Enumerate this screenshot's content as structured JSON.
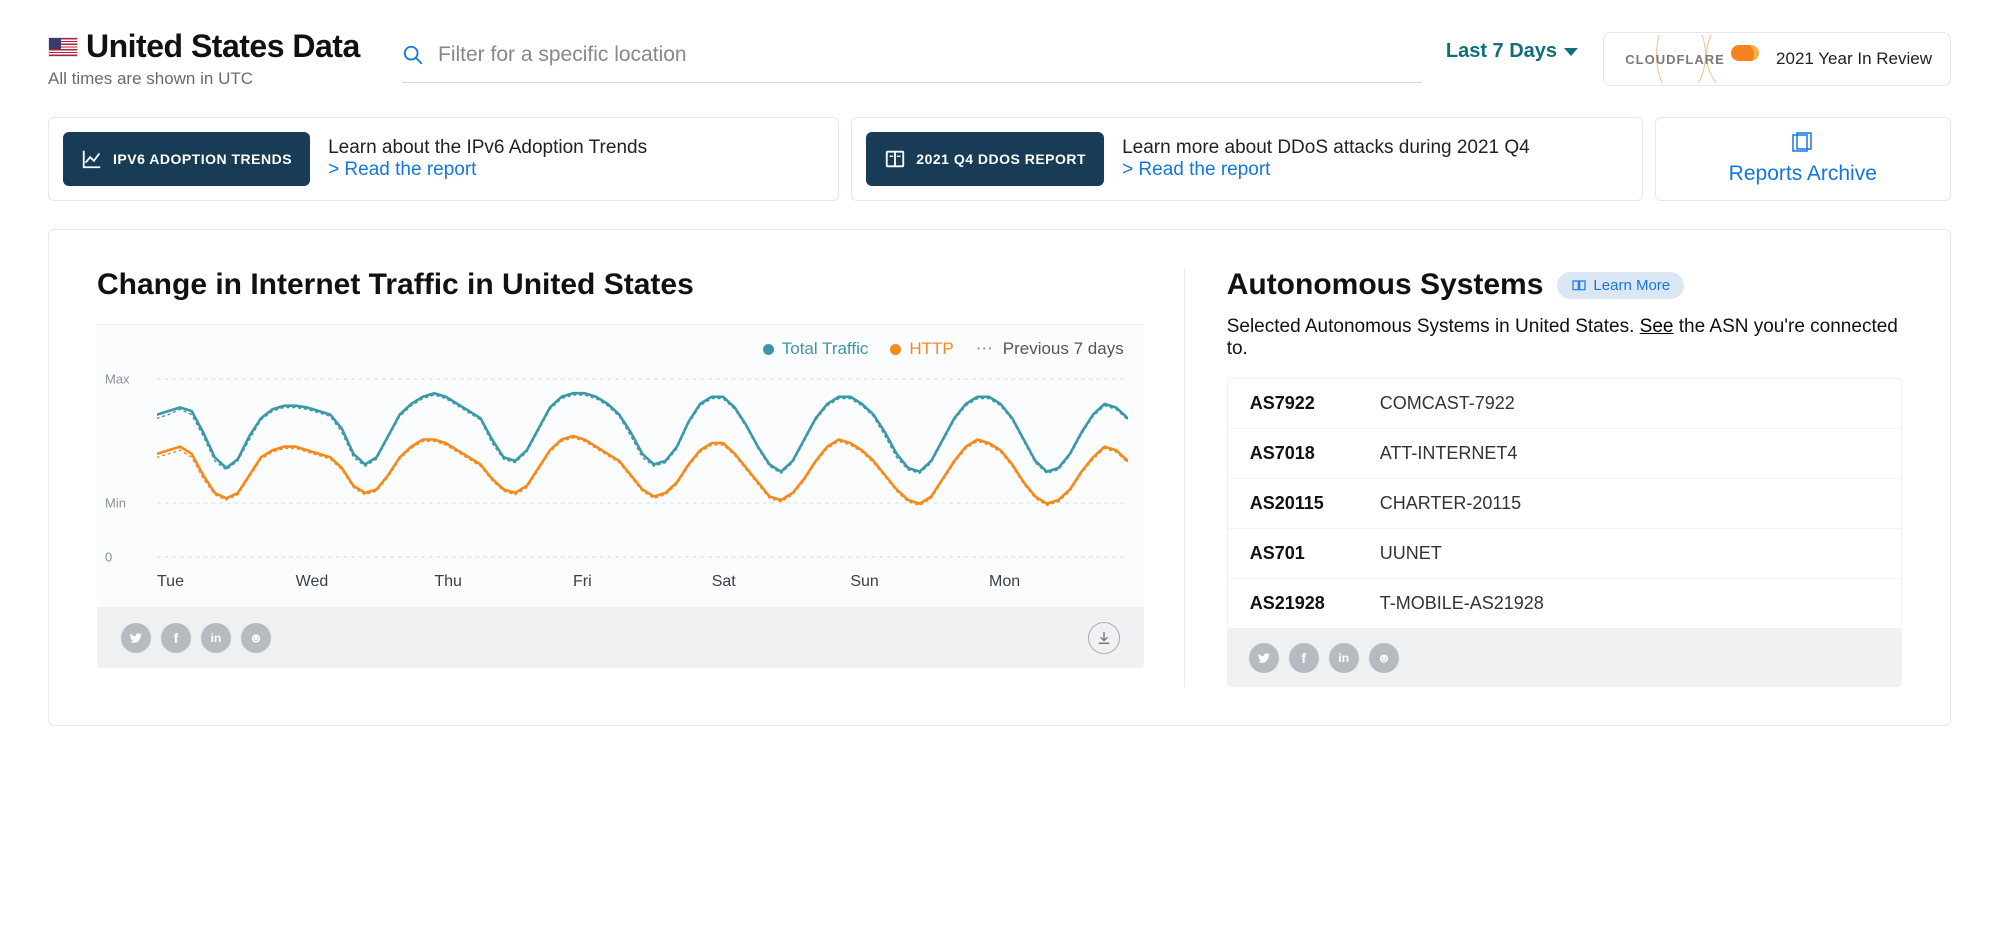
{
  "header": {
    "title": "United States Data",
    "tz_note": "All times are shown in UTC",
    "search_placeholder": "Filter for a specific location",
    "range_label": "Last 7 Days",
    "year_review_label": "2021 Year In Review",
    "cloudflare_wordmark": "CLOUDFLARE"
  },
  "promos": {
    "ipv6": {
      "badge": "IPV6 ADOPTION TRENDS",
      "headline": "Learn about the IPv6 Adoption Trends",
      "link": "> Read the report"
    },
    "ddos": {
      "badge": "2021 Q4 DDOS REPORT",
      "headline": "Learn more about DDoS attacks during 2021 Q4",
      "link": "> Read the report"
    },
    "archive_label": "Reports Archive"
  },
  "chart_panel": {
    "title": "Change in Internet Traffic in United States",
    "legend": {
      "total": "Total Traffic",
      "http": "HTTP",
      "prev": "Previous 7 days"
    },
    "y_ticks": [
      "Max",
      "Min",
      "0"
    ]
  },
  "chart_data": {
    "type": "line",
    "xlabel": "",
    "ylabel": "",
    "ylim_labels": [
      "0",
      "Min",
      "Max"
    ],
    "y_range_note": "normalized 0–100, Max≈100, Min≈30, 0 baseline at bottom",
    "categories": [
      "Tue",
      "Wed",
      "Thu",
      "Fri",
      "Sat",
      "Sun",
      "Mon"
    ],
    "x": [
      0,
      2,
      4,
      6,
      8,
      10,
      12,
      14,
      16,
      18,
      20,
      22,
      24,
      26,
      28,
      30,
      32,
      34,
      36,
      38,
      40,
      42,
      44,
      46,
      48,
      50,
      52,
      54,
      56,
      58,
      60,
      62,
      64,
      66,
      68,
      70,
      72,
      74,
      76,
      78,
      80,
      82,
      84,
      86,
      88,
      90,
      92,
      94,
      96,
      98,
      100,
      102,
      104,
      106,
      108,
      110,
      112,
      114,
      116,
      118,
      120,
      122,
      124,
      126,
      128,
      130,
      132,
      134,
      136,
      138,
      140,
      142,
      144,
      146,
      148,
      150,
      152,
      154,
      156,
      158,
      160,
      162,
      164,
      166,
      168
    ],
    "series": [
      {
        "name": "Total Traffic",
        "color": "#3a98a8",
        "values": [
          80,
          82,
          84,
          82,
          70,
          56,
          50,
          55,
          68,
          78,
          83,
          85,
          85,
          84,
          82,
          80,
          72,
          58,
          52,
          56,
          68,
          80,
          86,
          90,
          92,
          90,
          86,
          82,
          78,
          66,
          56,
          54,
          60,
          72,
          84,
          90,
          92,
          92,
          90,
          86,
          80,
          70,
          58,
          52,
          54,
          62,
          76,
          86,
          90,
          90,
          84,
          74,
          62,
          52,
          48,
          54,
          66,
          78,
          86,
          90,
          90,
          86,
          80,
          70,
          58,
          50,
          48,
          54,
          66,
          78,
          86,
          90,
          90,
          86,
          78,
          66,
          54,
          48,
          50,
          58,
          70,
          80,
          86,
          84,
          78
        ]
      },
      {
        "name": "HTTP",
        "color": "#f48a1c",
        "values": [
          58,
          60,
          62,
          58,
          46,
          36,
          33,
          36,
          46,
          56,
          60,
          62,
          62,
          60,
          58,
          56,
          50,
          40,
          36,
          38,
          46,
          56,
          62,
          66,
          66,
          64,
          60,
          56,
          52,
          44,
          38,
          36,
          40,
          50,
          60,
          66,
          68,
          66,
          62,
          58,
          54,
          46,
          38,
          34,
          36,
          42,
          52,
          60,
          64,
          64,
          58,
          50,
          42,
          34,
          32,
          36,
          44,
          54,
          62,
          66,
          64,
          60,
          54,
          46,
          38,
          32,
          30,
          34,
          44,
          54,
          62,
          66,
          64,
          60,
          52,
          42,
          34,
          30,
          32,
          38,
          48,
          56,
          62,
          60,
          54
        ]
      },
      {
        "name": "Total Traffic (prev 7 days)",
        "color": "#3a98a8",
        "style": "dotted",
        "values": [
          78,
          80,
          83,
          80,
          68,
          54,
          49,
          54,
          66,
          77,
          82,
          84,
          84,
          83,
          81,
          79,
          70,
          56,
          51,
          55,
          67,
          79,
          85,
          89,
          91,
          89,
          85,
          81,
          77,
          64,
          55,
          53,
          59,
          71,
          83,
          89,
          91,
          91,
          89,
          85,
          79,
          68,
          56,
          51,
          53,
          61,
          75,
          85,
          89,
          89,
          83,
          73,
          61,
          51,
          47,
          53,
          65,
          77,
          85,
          89,
          89,
          85,
          79,
          68,
          56,
          49,
          47,
          53,
          65,
          77,
          85,
          89,
          89,
          85,
          77,
          65,
          53,
          47,
          49,
          57,
          69,
          79,
          85,
          83,
          77
        ]
      },
      {
        "name": "HTTP (prev 7 days)",
        "color": "#f48a1c",
        "style": "dotted",
        "values": [
          56,
          58,
          60,
          56,
          44,
          35,
          32,
          35,
          45,
          55,
          59,
          61,
          61,
          59,
          57,
          55,
          49,
          39,
          35,
          37,
          45,
          55,
          61,
          65,
          65,
          63,
          59,
          55,
          51,
          43,
          37,
          35,
          39,
          49,
          59,
          65,
          67,
          65,
          61,
          57,
          53,
          45,
          37,
          33,
          35,
          41,
          51,
          59,
          63,
          63,
          57,
          49,
          41,
          33,
          31,
          35,
          43,
          53,
          61,
          65,
          63,
          59,
          53,
          45,
          37,
          31,
          29,
          33,
          43,
          53,
          61,
          65,
          63,
          59,
          51,
          41,
          33,
          29,
          31,
          37,
          47,
          55,
          61,
          59,
          53
        ]
      }
    ]
  },
  "asn_panel": {
    "title": "Autonomous Systems",
    "learn_more": "Learn More",
    "desc_pre": "Selected Autonomous Systems in United States. ",
    "desc_link": "See",
    "desc_post": " the ASN you're connected to.",
    "rows": [
      {
        "code": "AS7922",
        "name": "COMCAST-7922"
      },
      {
        "code": "AS7018",
        "name": "ATT-INTERNET4"
      },
      {
        "code": "AS20115",
        "name": "CHARTER-20115"
      },
      {
        "code": "AS701",
        "name": "UUNET"
      },
      {
        "code": "AS21928",
        "name": "T-MOBILE-AS21928"
      }
    ]
  }
}
